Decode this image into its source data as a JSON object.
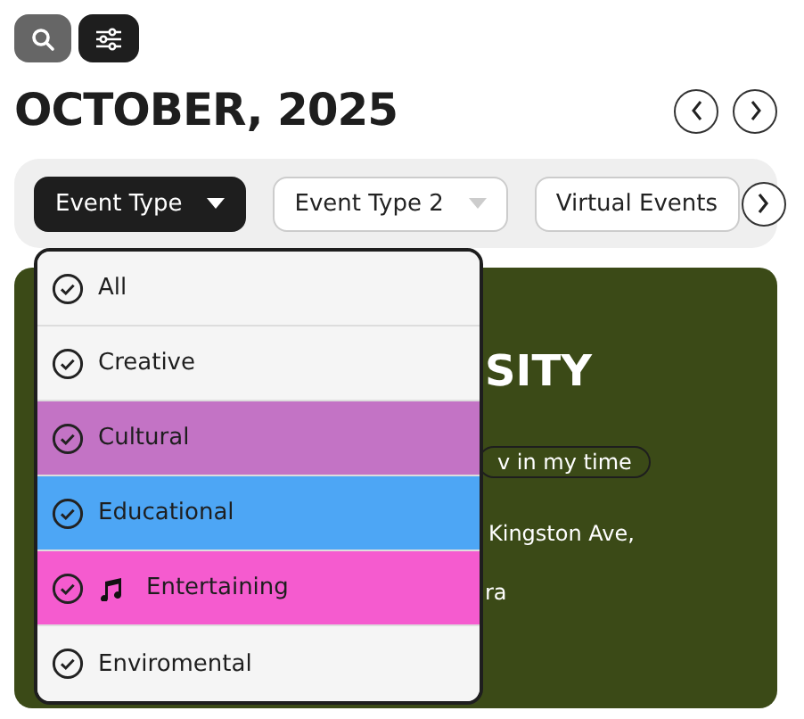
{
  "title": "OCTOBER, 2025",
  "filters": [
    {
      "label": "Event Type",
      "selected": true,
      "kind": "dropdown"
    },
    {
      "label": "Event Type 2",
      "selected": false,
      "kind": "dropdown"
    },
    {
      "label": "Virtual Events",
      "selected": false,
      "kind": "toggle"
    }
  ],
  "dropdown": {
    "items": [
      {
        "label": "All",
        "color": "#f5f5f5",
        "kind": "plain"
      },
      {
        "label": "Creative",
        "color": "#f5f5f5",
        "kind": "plain"
      },
      {
        "label": "Cultural",
        "color": "#c373c5",
        "kind": "plain"
      },
      {
        "label": "Educational",
        "color": "#4da6f5",
        "kind": "plain"
      },
      {
        "label": "Entertaining",
        "color": "#f55bcf",
        "kind": "music"
      },
      {
        "label": "Enviromental",
        "color": "#f5f5f5",
        "kind": "plain"
      }
    ]
  },
  "event_card": {
    "title": "SITY",
    "time_button": "v in my time",
    "address": "Kingston Ave,",
    "venue": "ra"
  }
}
